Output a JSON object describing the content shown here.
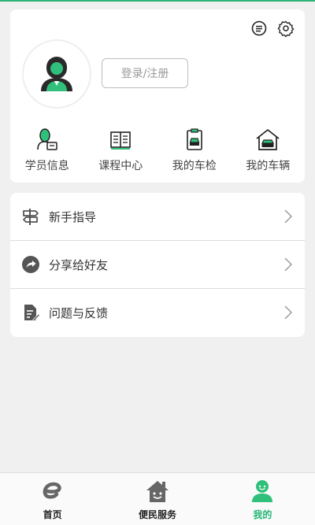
{
  "colors": {
    "accent": "#2bb673",
    "active_tab": "#22b573",
    "background": "#f0f0f0",
    "card": "#ffffff"
  },
  "profile": {
    "login_label": "登录/注册",
    "icons": [
      "message-icon",
      "settings-icon"
    ]
  },
  "shortcuts": [
    {
      "label": "学员信息",
      "icon": "student-info-icon"
    },
    {
      "label": "课程中心",
      "icon": "course-book-icon"
    },
    {
      "label": "我的车检",
      "icon": "vehicle-inspection-icon"
    },
    {
      "label": "我的车辆",
      "icon": "garage-car-icon"
    }
  ],
  "menu": [
    {
      "label": "新手指导",
      "icon": "signpost-icon"
    },
    {
      "label": "分享给好友",
      "icon": "share-icon"
    },
    {
      "label": "问题与反馈",
      "icon": "feedback-document-icon"
    }
  ],
  "tabbar": {
    "tabs": [
      {
        "label": "首页",
        "icon": "home-e-icon"
      },
      {
        "label": "便民服务",
        "icon": "house-smile-icon"
      },
      {
        "label": "我的",
        "icon": "user-icon",
        "active": true
      }
    ]
  }
}
